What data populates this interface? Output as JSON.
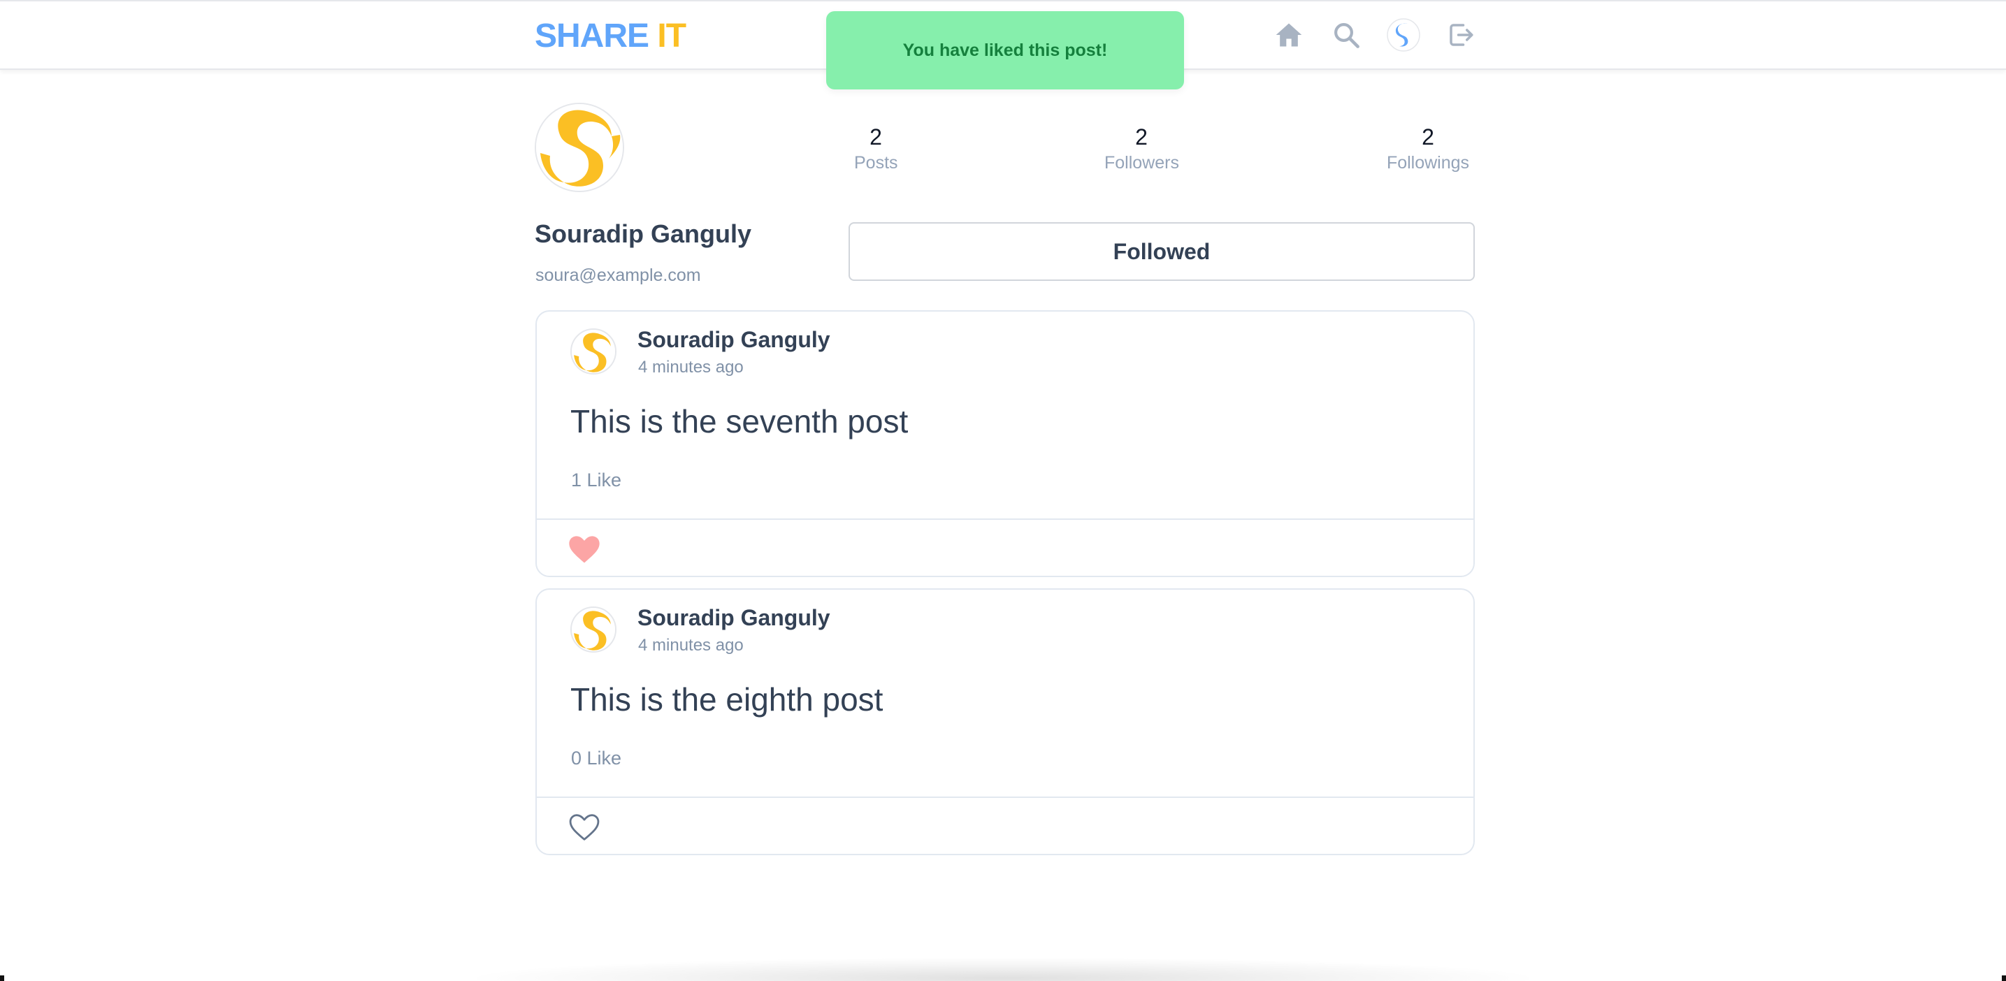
{
  "header": {
    "logo_part1": "SHARE",
    "logo_part2": "IT",
    "icons": [
      "home-icon",
      "search-icon",
      "profile-avatar-icon",
      "logout-icon"
    ]
  },
  "toast": {
    "message": "You have liked this post!"
  },
  "profile": {
    "name": "Souradip Ganguly",
    "email": "soura@example.com",
    "stats": {
      "posts": {
        "value": "2",
        "label": "Posts"
      },
      "followers": {
        "value": "2",
        "label": "Followers"
      },
      "followings": {
        "value": "2",
        "label": "Followings"
      }
    },
    "follow_button_label": "Followed"
  },
  "posts": [
    {
      "author": "Souradip Ganguly",
      "time": "4 minutes ago",
      "content": "This is the seventh post",
      "likes_text": "1 Like",
      "liked": true
    },
    {
      "author": "Souradip Ganguly",
      "time": "4 minutes ago",
      "content": "This is the eighth post",
      "likes_text": "0 Like",
      "liked": false
    }
  ],
  "colors": {
    "logo_blue": "#60a5fa",
    "logo_yellow": "#fbbf24",
    "toast_bg": "#86efac",
    "toast_text": "#15803d",
    "liked_heart": "#fca5a5",
    "unliked_heart": "#64748b"
  }
}
